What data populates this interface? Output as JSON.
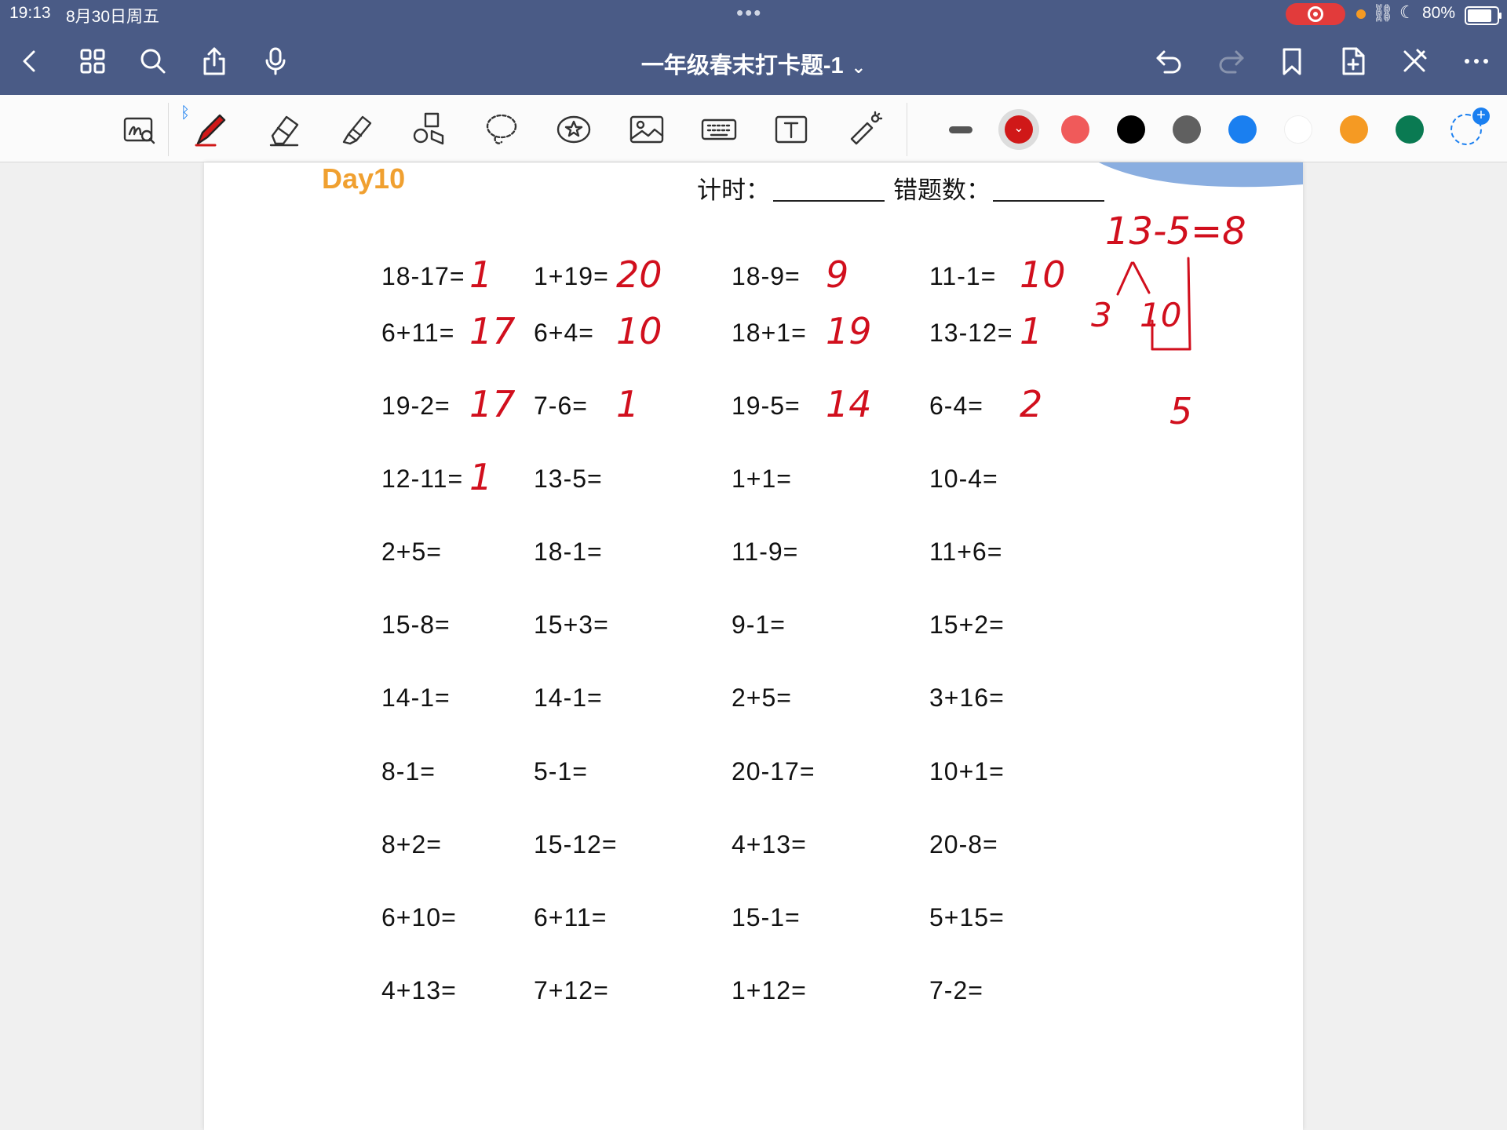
{
  "status_bar": {
    "time": "19:13",
    "date": "8月30日周五",
    "battery": "80%"
  },
  "app_bar": {
    "title": "一年级春末打卡题-1",
    "icons": [
      "back-icon",
      "grid-icon",
      "search-icon",
      "share-icon",
      "microphone-icon",
      "undo-icon",
      "redo-icon",
      "bookmark-icon",
      "add-page-icon",
      "close-tools-icon",
      "more-icon"
    ]
  },
  "tools": [
    "handwriting-zoom",
    "pen",
    "eraser",
    "highlighter",
    "shapes",
    "lasso",
    "sticker",
    "image",
    "keyboard",
    "text",
    "laser-pointer"
  ],
  "colors": {
    "bar": "#4a5b86",
    "accent_red": "#d10f1d",
    "day_orange": "#f0a030",
    "palette": [
      "#555555",
      "#d01818",
      "#f05a5a",
      "#000000",
      "#606060",
      "#1a7ff0",
      "#ffffff",
      "#f59a23",
      "#0a7a52"
    ]
  },
  "worksheet": {
    "day": "Day10",
    "timer_label": "计时：",
    "errors_label": "错题数：",
    "problems": [
      [
        "18-17=",
        "1+19=",
        "18-9=",
        "11-1="
      ],
      [
        "6+11=",
        "6+4=",
        "18+1=",
        "13-12="
      ],
      [
        "19-2=",
        "7-6=",
        "19-5=",
        "6-4="
      ],
      [
        "12-11=",
        "13-5=",
        "1+1=",
        "10-4="
      ],
      [
        "2+5=",
        "18-1=",
        "11-9=",
        "11+6="
      ],
      [
        "15-8=",
        "15+3=",
        "9-1=",
        "15+2="
      ],
      [
        "14-1=",
        "14-1=",
        "2+5=",
        "3+16="
      ],
      [
        "8-1=",
        "5-1=",
        "20-17=",
        "10+1="
      ],
      [
        "8+2=",
        "15-12=",
        "4+13=",
        "20-8="
      ],
      [
        "6+10=",
        "6+11=",
        "15-1=",
        "5+15="
      ],
      [
        "4+13=",
        "7+12=",
        "1+12=",
        "7-2="
      ]
    ],
    "answers": [
      [
        "1",
        "20",
        "9",
        "10"
      ],
      [
        "17",
        "10",
        "19",
        "1"
      ],
      [
        "17",
        "1",
        "14",
        "2"
      ],
      [
        "1",
        "",
        "",
        ""
      ]
    ],
    "work": {
      "equation": "13-5=8",
      "split_left": "3",
      "split_right": "10",
      "result": "5"
    }
  }
}
